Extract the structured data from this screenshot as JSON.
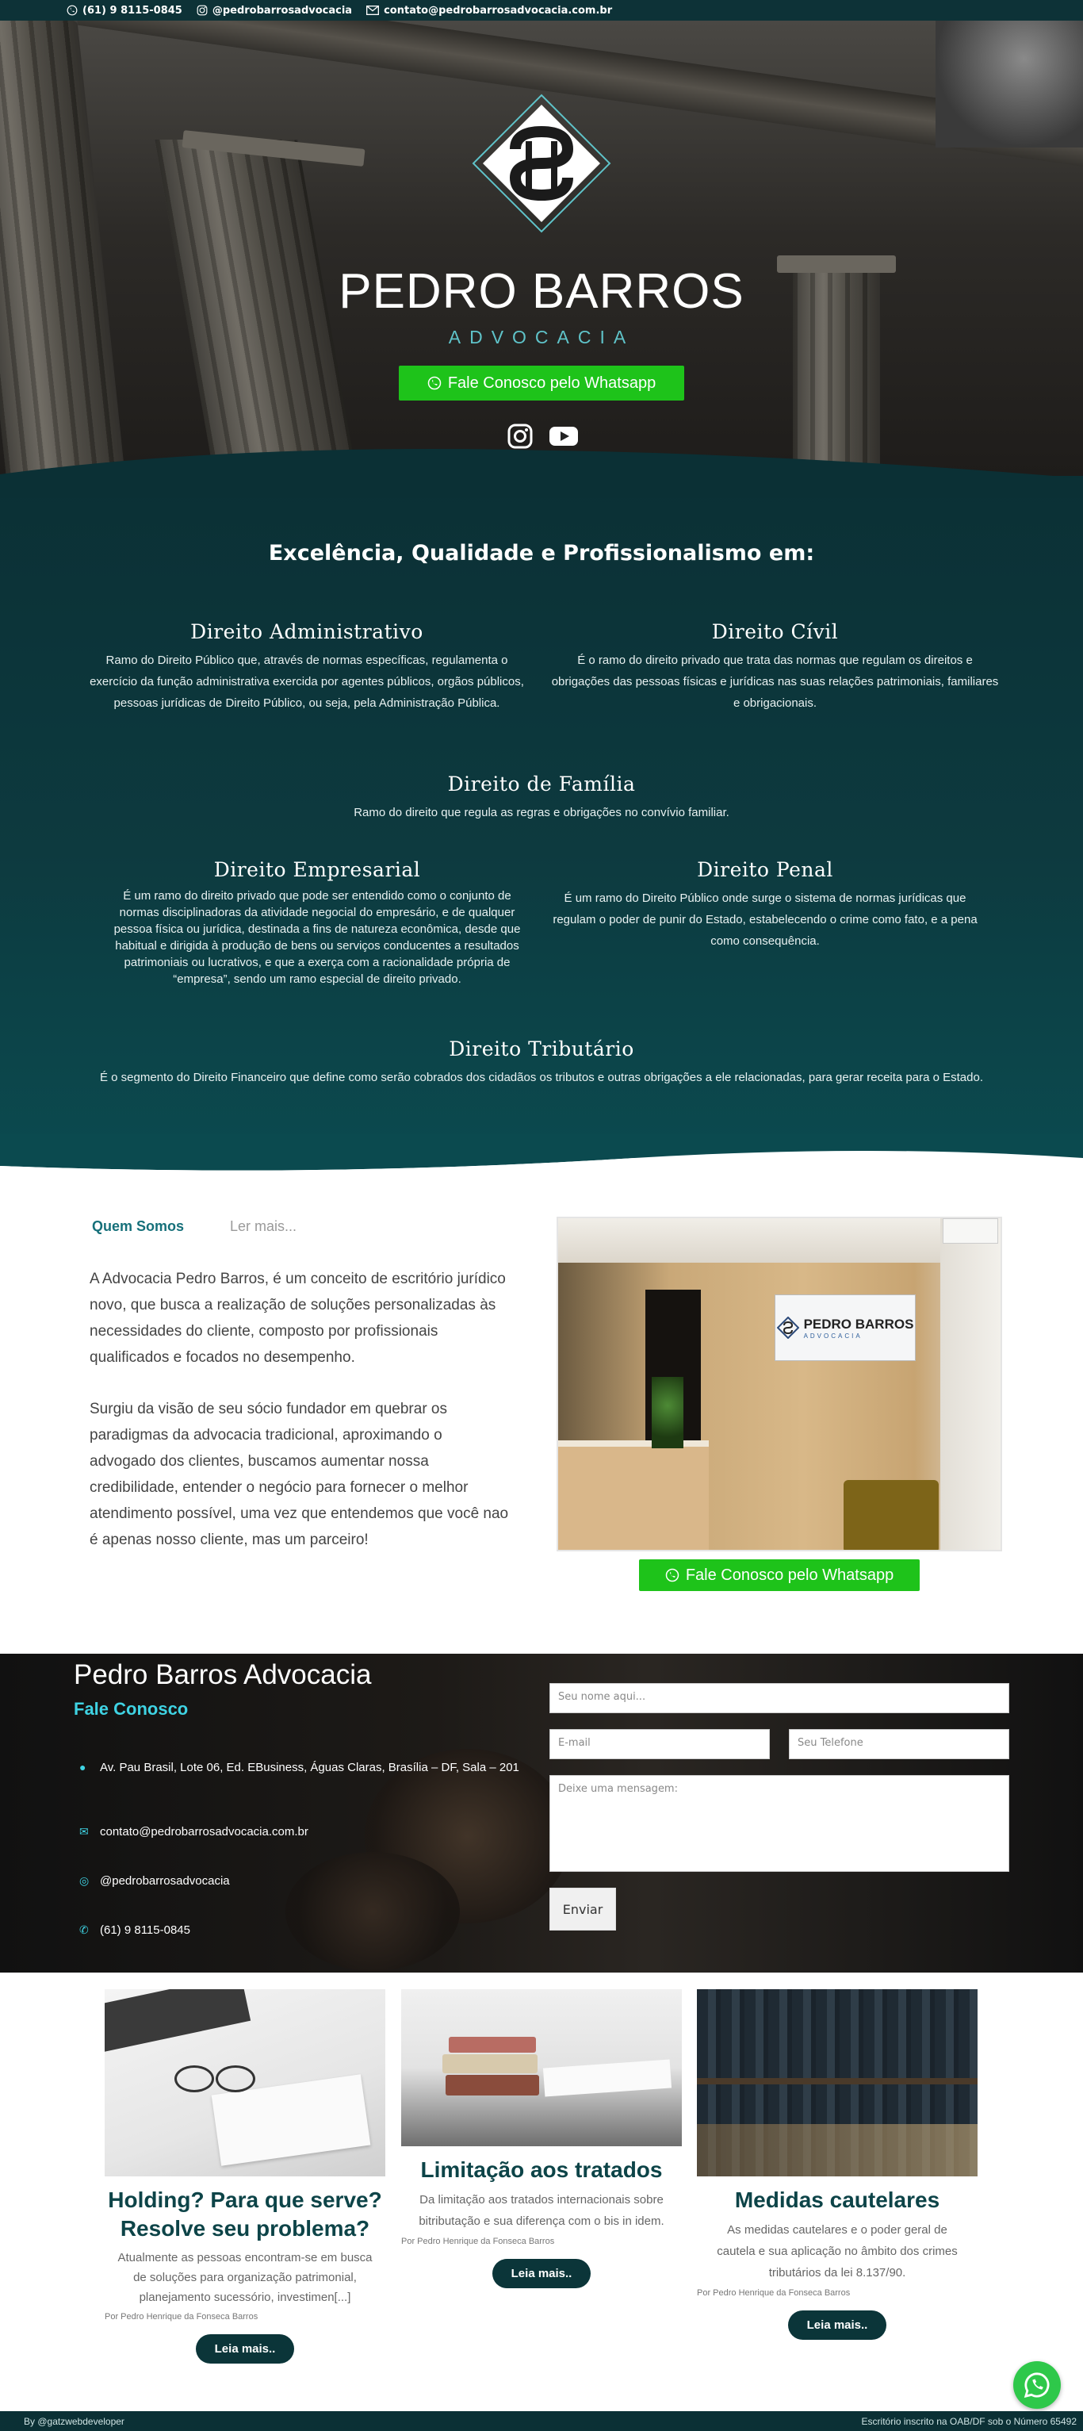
{
  "topbar": {
    "phone": "(61) 9 8115-0845",
    "instagram": "@pedrobarrosadvocacia",
    "email": "contato@pedrobarrosadvocacia.com.br"
  },
  "hero": {
    "brand": "PEDRO BARROS",
    "brand_sub": "ADVOCACIA",
    "whatsapp_label": "Fale Conosco pelo Whatsapp",
    "social": [
      "instagram-icon",
      "youtube-icon"
    ]
  },
  "areas": {
    "title": "Excelência, Qualidade e Profissionalismo em:",
    "items": [
      {
        "title": "Direito Administrativo",
        "text": "Ramo do Direito Público que, através de normas específicas, regulamenta o exercício da função administrativa exercida por agentes públicos, orgãos públicos, pessoas jurídicas de Direito Público, ou seja, pela Administração Pública."
      },
      {
        "title": "Direito Cívil",
        "text": "É o ramo do direito privado que trata das normas que regulam os direitos e obrigações das pessoas físicas e jurídicas nas suas relações patrimoniais, familiares e obrigacionais."
      },
      {
        "title": "Direito de Família",
        "text": "Ramo do direito que regula as regras e obrigações no convívio familiar."
      },
      {
        "title": "Direito Empresarial",
        "text": "É um ramo do direito privado que pode ser entendido como o conjunto de normas disciplinadoras da atividade negocial do empresário, e de qualquer pessoa física ou jurídica, destinada a fins de natureza econômica, desde que habitual e dirigida à produção de bens ou serviços conducentes a resultados patrimoniais ou lucrativos, e que a exerça com a racionalidade própria de “empresa”, sendo um ramo especial de direito privado."
      },
      {
        "title": "Direito Penal",
        "text": "É um ramo do Direito Público onde surge o sistema de normas jurídicas que regulam o poder de punir do Estado, estabelecendo o crime como fato, e a pena como consequência."
      },
      {
        "title": "Direito Tributário",
        "text": "É o segmento do Direito Financeiro que define como serão cobrados dos cidadãos os tributos e outras obrigações a ele relacionadas, para gerar receita para o Estado."
      }
    ]
  },
  "about": {
    "tab_active": "Quem Somos",
    "tab_more": "Ler mais...",
    "p1": "A Advocacia Pedro Barros, é um conceito de escritório jurídico novo, que busca a realização de soluções personalizadas às necessidades do cliente, composto por profissionais qualificados e focados no desempenho.",
    "p2": "Surgiu da visão de seu sócio fundador em quebrar os paradigmas da advocacia tradicional, aproximando o advogado dos clientes, buscamos aumentar nossa credibilidade, entender o negócio para fornecer o melhor atendimento possível, uma vez que entendemos que você nao é apenas nosso cliente, mas um parceiro!",
    "sign_name": "PEDRO BARROS",
    "sign_sub": "ADVOCACIA",
    "whatsapp_label": "Fale Conosco pelo Whatsapp"
  },
  "contact": {
    "title": "Pedro Barros Advocacia",
    "subtitle": "Fale Conosco",
    "address": "Av. Pau Brasil, Lote 06, Ed. EBusiness, Águas Claras, Brasília – DF, Sala – 201",
    "email": "contato@pedrobarrosadvocacia.com.br",
    "instagram": "@pedrobarrosadvocacia",
    "phone": "(61) 9 8115-0845",
    "form": {
      "name_placeholder": "Seu nome aqui...",
      "email_placeholder": "E-mail",
      "phone_placeholder": "Seu Telefone",
      "message_placeholder": "Deixe uma mensagem:",
      "send_label": "Enviar"
    }
  },
  "blog": {
    "posts": [
      {
        "title": "Holding? Para que serve? Resolve seu problema?",
        "excerpt": "Atualmente as pessoas encontram-se em busca de soluções para organização patrimonial, planejamento sucessório, investimen[...]",
        "author": "Por Pedro Henrique da Fonseca Barros",
        "read": "Leia mais.."
      },
      {
        "title": "Limitação aos tratados",
        "excerpt": "Da limitação aos tratados internacionais sobre bitributação e sua diferença com o bis in idem.",
        "author": "Por Pedro Henrique da Fonseca Barros",
        "read": "Leia mais.."
      },
      {
        "title": "Medidas cautelares",
        "excerpt": "As medidas cautelares e o poder geral de cautela e sua aplicação no âmbito dos crimes tributários da lei 8.137/90.",
        "author": "Por Pedro Henrique da Fonseca Barros",
        "read": "Leia mais.."
      }
    ]
  },
  "footer": {
    "left": "By @gatzwebdeveloper",
    "right": "Escritório inscrito na OAB/DF sob o Número 65492"
  },
  "colors": {
    "teal_dark": "#0b3035",
    "accent": "#3fd3e3",
    "whatsapp": "#1ec31a"
  }
}
